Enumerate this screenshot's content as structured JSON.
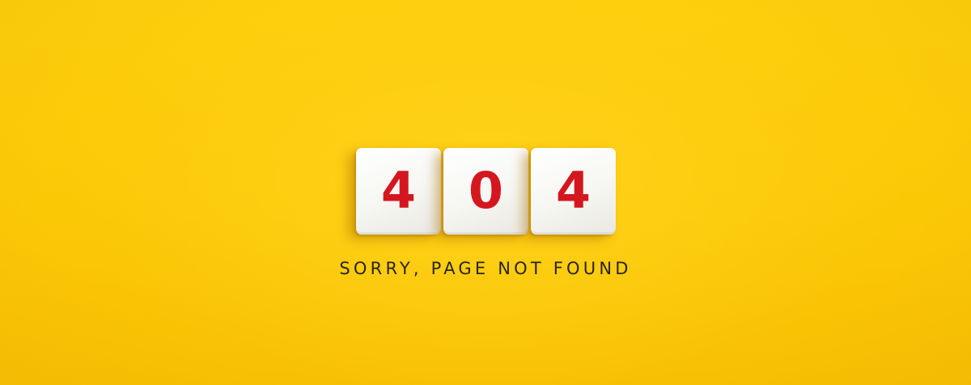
{
  "tiles": [
    "4",
    "0",
    "4"
  ],
  "caption": "SORRY, PAGE NOT FOUND",
  "colors": {
    "background": "#fbc806",
    "tile": "#f6f6f2",
    "digit": "#d4171f",
    "caption": "#2a2418"
  }
}
